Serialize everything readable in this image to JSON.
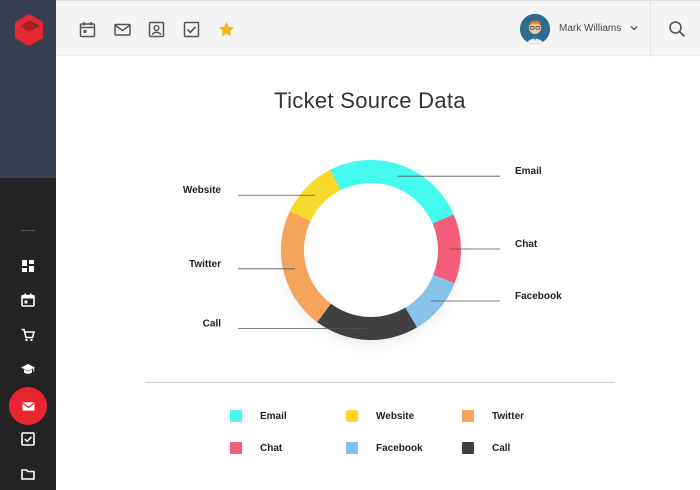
{
  "header": {
    "icons": [
      "calendar-icon",
      "mail-icon",
      "contact-icon",
      "checkbox-icon",
      "star-icon"
    ],
    "user_name": "Mark Williams",
    "star_color": "#f5b71d"
  },
  "sidebar": {
    "icons": [
      "dashboard-icon",
      "calendar-icon",
      "cart-icon",
      "graduation-cap-icon",
      "mail-icon",
      "checkbox-icon",
      "folder-icon"
    ],
    "active": "mail-icon",
    "active_color": "#e8262f"
  },
  "chart_data": {
    "type": "donut",
    "title": "Ticket Source Data",
    "series": [
      {
        "name": "Email",
        "value": 25,
        "color": "#45fbf0"
      },
      {
        "name": "Chat",
        "value": 12,
        "color": "#f45d7a"
      },
      {
        "name": "Facebook",
        "value": 10,
        "color": "#86c3ea"
      },
      {
        "name": "Call",
        "value": 18,
        "color": "#404043"
      },
      {
        "name": "Twitter",
        "value": 21,
        "color": "#f5a45c"
      },
      {
        "name": "Website",
        "value": 10,
        "color": "#f7da2b"
      }
    ],
    "legend_order": [
      "Email",
      "Website",
      "Twitter",
      "Chat",
      "Facebook",
      "Call"
    ],
    "legend_position": "bottom"
  }
}
